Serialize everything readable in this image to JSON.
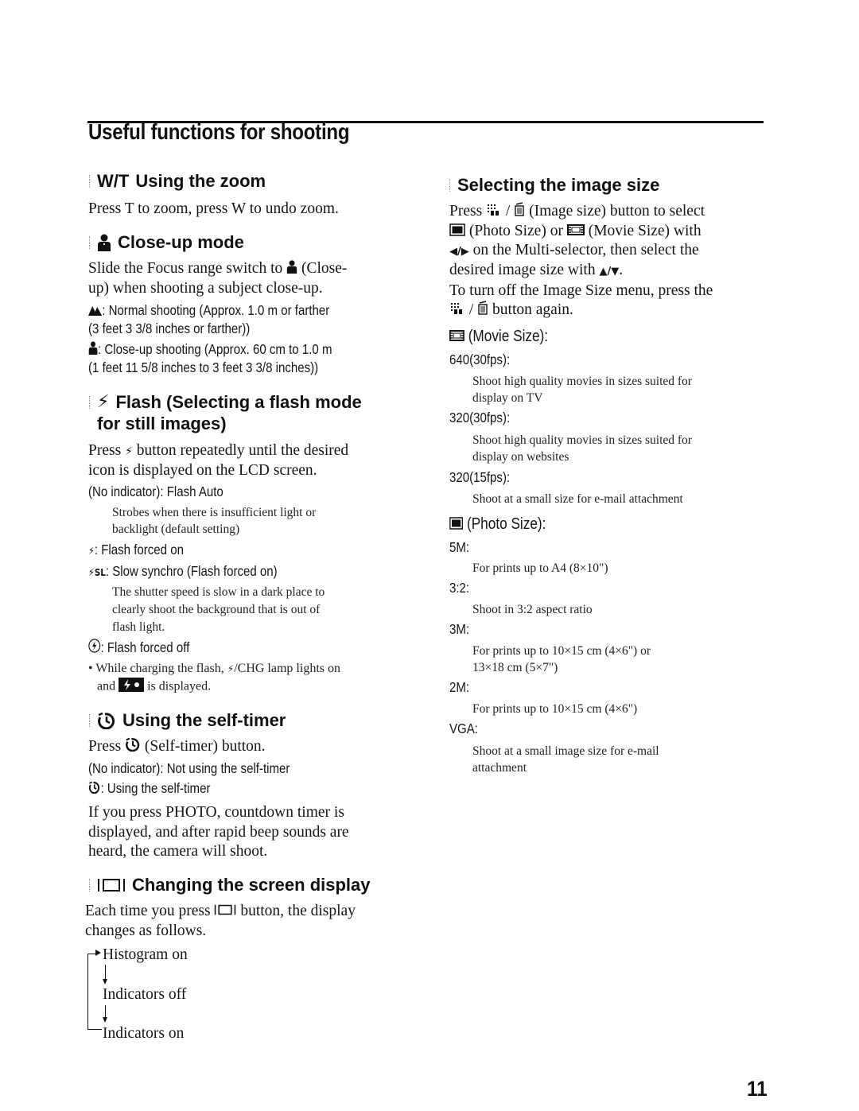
{
  "page": {
    "title": "Useful functions for shooting",
    "page_number": "11"
  },
  "left": {
    "zoom": {
      "icon_label": "W/T",
      "heading": "Using the zoom",
      "body": "Press T to zoom, press W to undo zoom."
    },
    "closeup": {
      "heading": "Close-up mode",
      "body_line1": "Slide the Focus range switch to",
      "body_line1_tail": "(Close-",
      "body_line2": "up) when shooting a subject close-up.",
      "normal_label": ": Normal shooting (Approx. 1.0 m or farther",
      "normal_label2": "(3 feet 3 3/8 inches or farther))",
      "close_label": ": Close-up shooting (Approx. 60 cm to 1.0 m",
      "close_label2": "(1 feet 11 5/8 inches to 3 feet 3 3/8 inches))"
    },
    "flash": {
      "heading_line1": "Flash (Selecting a flash mode",
      "heading_line2": "for still images)",
      "body_pre": "Press",
      "body_post": "button repeatedly until the desired",
      "body_line2": "icon is displayed on the LCD screen.",
      "modes": [
        {
          "label": "(No indicator): Flash Auto",
          "desc_line1": "Strobes when there is insufficient light or",
          "desc_line2": "backlight (default setting)"
        },
        {
          "label": ": Flash forced on"
        },
        {
          "label": ": Slow synchro (Flash forced on)",
          "desc_line1": "The shutter speed is slow in a dark place to",
          "desc_line2": "clearly shoot the background that is out of",
          "desc_line3": "flash light."
        },
        {
          "label": ": Flash forced off"
        }
      ],
      "sl_suffix": "SL",
      "note_pre": "While charging the flash,",
      "note_mid": "/CHG lamp lights on",
      "note_line2_pre": "and",
      "note_line2_post": "is displayed."
    },
    "selftimer": {
      "heading": "Using the self-timer",
      "body_pre": "Press",
      "body_post": "(Self-timer) button.",
      "mode1": "(No indicator): Not using the self-timer",
      "mode2": ": Using the self-timer",
      "para_line1": "If you press PHOTO, countdown timer is",
      "para_line2": "displayed, and after rapid beep sounds are",
      "para_line3": "heard, the camera will shoot."
    },
    "display": {
      "heading": "Changing the screen display",
      "body_pre": "Each time you press",
      "body_post": "button, the display",
      "body_line2": "changes as follows.",
      "cycle": [
        "Histogram on",
        "Indicators off",
        "Indicators on"
      ]
    }
  },
  "right": {
    "imagesize": {
      "heading": "Selecting the image size",
      "line1_pre": "Press",
      "line1_post": "(Image size) button to select",
      "line2_a": "(Photo Size) or",
      "line2_b": "(Movie Size) with",
      "line3": "on the Multi-selector, then select the",
      "line4": "desired image size with",
      "line5": "To turn off the Image Size menu, press the",
      "line6": "button again.",
      "movie": {
        "title": "(Movie Size):",
        "items": [
          {
            "label": "640(30fps):",
            "desc_line1": "Shoot high quality movies in sizes suited for",
            "desc_line2": "display on TV"
          },
          {
            "label": "320(30fps):",
            "desc_line1": "Shoot high quality movies in sizes suited for",
            "desc_line2": "display on websites"
          },
          {
            "label": "320(15fps):",
            "desc_line1": "Shoot at a small size for e-mail attachment"
          }
        ]
      },
      "photo": {
        "title": "(Photo Size):",
        "items": [
          {
            "label": "5M:",
            "desc_line1": "For prints up to A4 (8×10\")"
          },
          {
            "label": "3:2:",
            "desc_line1": "Shoot in 3:2 aspect ratio"
          },
          {
            "label": "3M:",
            "desc_line1": "For prints up to 10×15 cm (4×6\") or",
            "desc_line2": "13×18 cm (5×7\")"
          },
          {
            "label": "2M:",
            "desc_line1": "For prints up to 10×15 cm (4×6\")"
          },
          {
            "label": "VGA:",
            "desc_line1": "Shoot at a small image size for e-mail",
            "desc_line2": "attachment"
          }
        ]
      }
    }
  }
}
